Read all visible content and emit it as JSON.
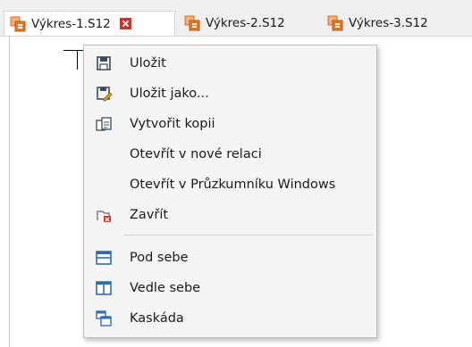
{
  "tabs": [
    {
      "label": "Výkres-1.S12",
      "active": true,
      "has_close": true
    },
    {
      "label": "Výkres-2.S12",
      "active": false
    },
    {
      "label": "Výkres-3.S12",
      "active": false
    }
  ],
  "menu": {
    "items": [
      {
        "label": "Uložit",
        "icon": "save-icon"
      },
      {
        "label": "Uložit jako...",
        "icon": "save-as-icon"
      },
      {
        "label": "Vytvořit kopii",
        "icon": "copy-icon"
      },
      {
        "label": "Otevřít v nové relaci",
        "icon": ""
      },
      {
        "label": "Otevřít v Průzkumníku Windows",
        "icon": ""
      },
      {
        "label": "Zavřít",
        "icon": "close-tab-icon"
      },
      {
        "label": "Pod sebe",
        "icon": "tile-horizontal-icon"
      },
      {
        "label": "Vedle sebe",
        "icon": "tile-vertical-icon"
      },
      {
        "label": "Kaskáda",
        "icon": "cascade-icon"
      }
    ]
  },
  "colors": {
    "accent_blue": "#2e6db4",
    "doc_icon_orange": "#e07a2a",
    "close_red": "#c0392b"
  }
}
